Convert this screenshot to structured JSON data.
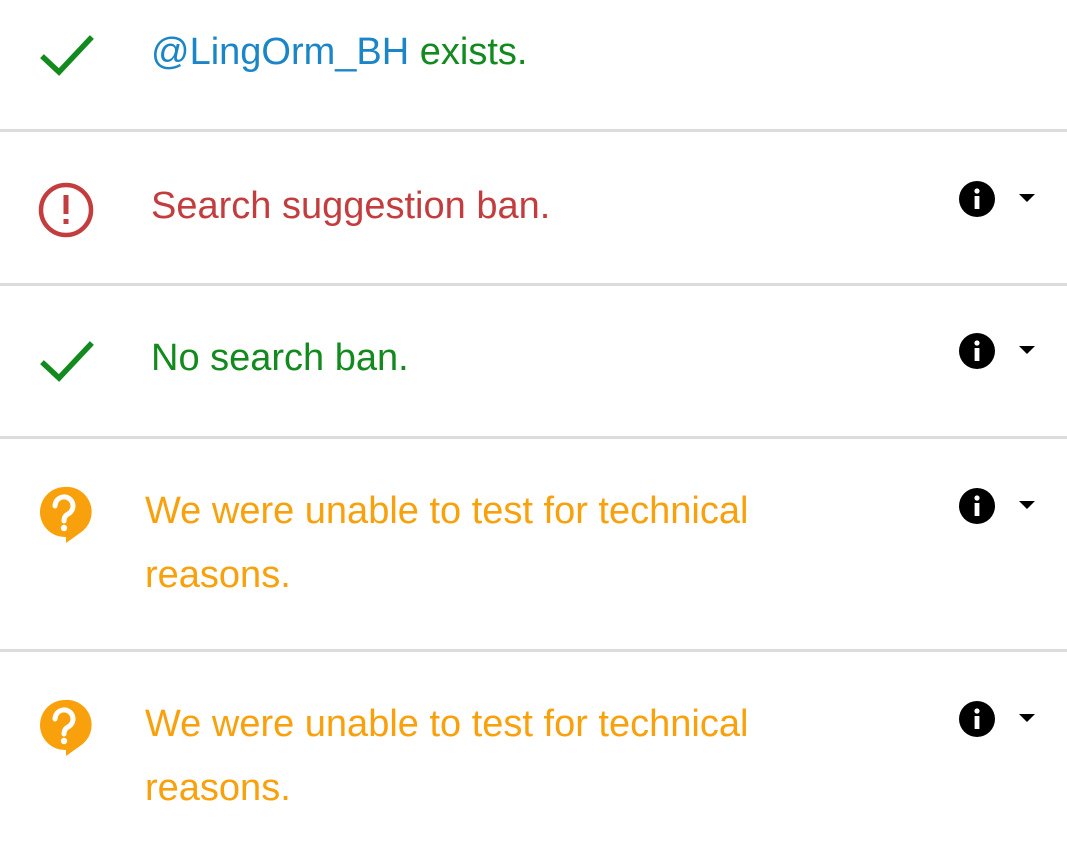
{
  "colors": {
    "success": "#128a1e",
    "error": "#c33c3e",
    "warning": "#f8a10c",
    "link": "#1a86c7",
    "divider": "#dcdcdc",
    "icon_dark": "#000000"
  },
  "results": [
    {
      "status": "success",
      "icon": "check-icon",
      "handle": "@LingOrm_BH",
      "text": " exists.",
      "has_controls": false
    },
    {
      "status": "error",
      "icon": "alert-circle-icon",
      "text": "Search suggestion ban.",
      "has_controls": true
    },
    {
      "status": "success",
      "icon": "check-icon",
      "text": "No search ban.",
      "has_controls": true
    },
    {
      "status": "warning",
      "icon": "question-bubble-icon",
      "text": "We were unable to test for technical reasons.",
      "has_controls": true
    },
    {
      "status": "warning",
      "icon": "question-bubble-icon",
      "text": "We were unable to test for technical reasons.",
      "has_controls": true
    }
  ],
  "controls": {
    "info_icon": "info-icon",
    "expand_icon": "caret-down-icon"
  }
}
